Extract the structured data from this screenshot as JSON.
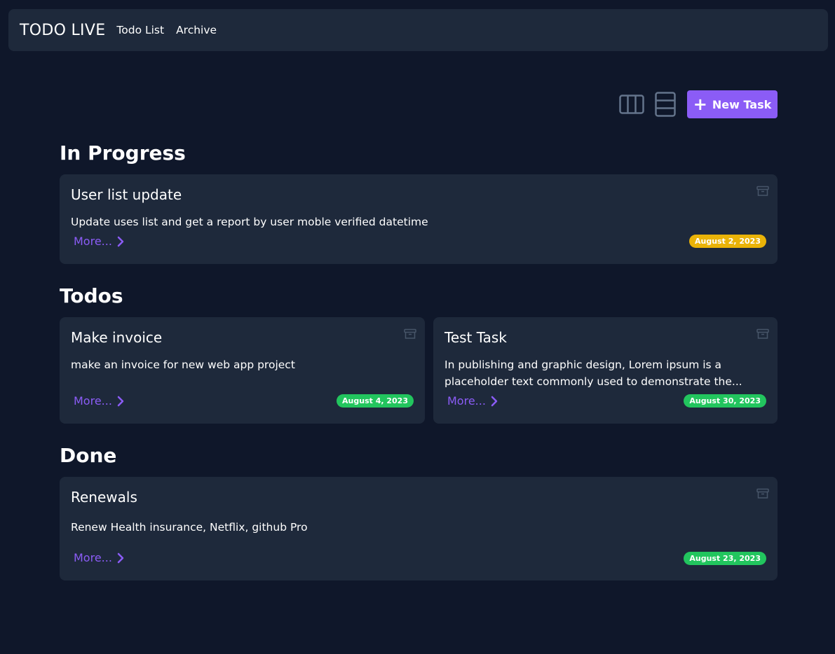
{
  "app": {
    "brand": "TODO LIVE",
    "nav": [
      {
        "label": "Todo List"
      },
      {
        "label": "Archive"
      }
    ]
  },
  "toolbar": {
    "columns_view_icon": "columns-icon",
    "rows_view_icon": "rows-icon",
    "new_task_icon": "plus-icon",
    "new_task_label": "New Task"
  },
  "sections": {
    "in_progress": {
      "title": "In Progress",
      "cards": [
        {
          "title": "User list update",
          "description": "Update uses list and get a report by user moble verified datetime",
          "more_label": "More...",
          "date": "August 2, 2023",
          "badge_color": "#eab308"
        }
      ]
    },
    "todos": {
      "title": "Todos",
      "cards": [
        {
          "title": "Make invoice",
          "description": "make an invoice for new web app project",
          "more_label": "More...",
          "date": "August 4, 2023",
          "badge_color": "#22c55e"
        },
        {
          "title": "Test Task",
          "description": "In publishing and graphic design, Lorem ipsum is a placeholder text commonly used to demonstrate the...",
          "more_label": "More...",
          "date": "August 30, 2023",
          "badge_color": "#22c55e"
        }
      ]
    },
    "done": {
      "title": "Done",
      "cards": [
        {
          "title": "Renewals",
          "description": "Renew Health insurance, Netflix, github Pro",
          "more_label": "More...",
          "date": "August 23, 2023",
          "badge_color": "#22c55e"
        }
      ]
    }
  },
  "colors": {
    "background": "#0f172a",
    "surface": "#1e293b",
    "accent": "#8b5cf6",
    "warning": "#eab308",
    "success": "#22c55e"
  }
}
